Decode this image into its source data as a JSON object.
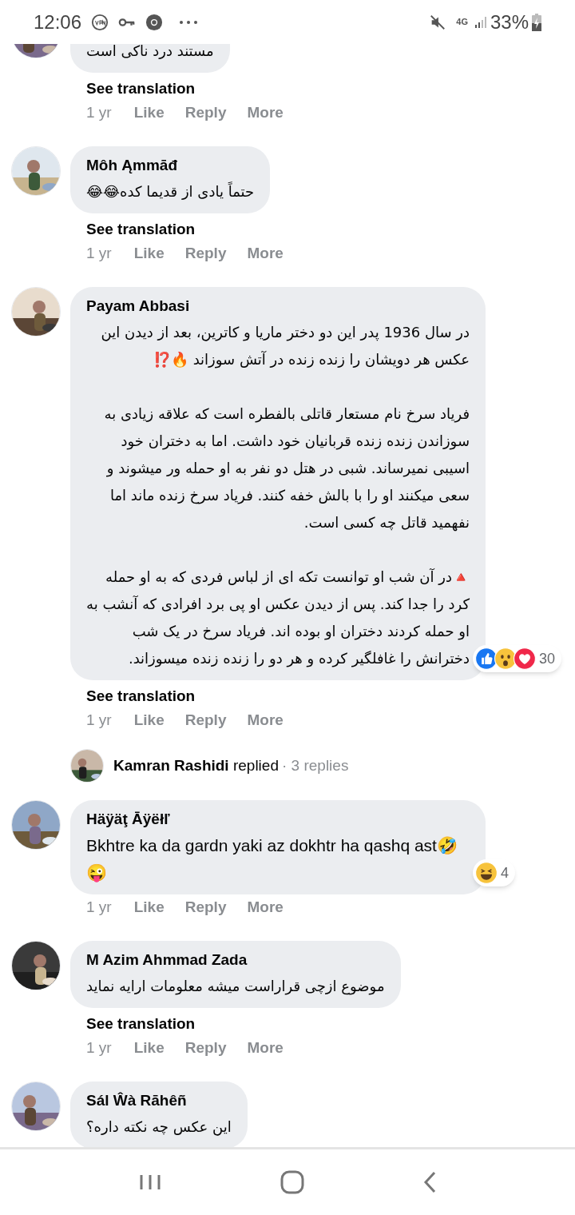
{
  "status_bar": {
    "time": "12:06",
    "network": "4G",
    "battery": "33%"
  },
  "comments": [
    {
      "kind": "comment",
      "clipped": true,
      "paragraphs": [
        "مستند درد ناکی است"
      ],
      "see_translation": "See translation",
      "time": "1 yr",
      "actions": [
        "Like",
        "Reply",
        "More"
      ]
    },
    {
      "kind": "comment",
      "author": "Môh Ąmmāđ",
      "paragraphs": [
        "حتماً یادی از قدیما کده😂😂"
      ],
      "see_translation": "See translation",
      "time": "1 yr",
      "actions": [
        "Like",
        "Reply",
        "More"
      ]
    },
    {
      "kind": "comment",
      "author": "Payam Abbasi",
      "paragraphs": [
        "در سال 1936 پدر این دو دختر ماریا و کاترین، بعد از دیدن این عکس هر دویشان را زنده زنده در آتش سوزاند 🔥⁉️",
        "فریاد سرخ نام مستعار قاتلی بالفطره است که علاقه زیادی به سوزاندن زنده زنده قربانیان خود داشت. اما به دختران خود اسیبی نمیرساند. شبی در هتل دو نفر به او حمله ور میشوند و سعی میکنند او را با بالش خفه کنند. فریاد سرخ زنده ماند اما نفهمید قاتل چه کسی است.",
        "🔺در آن شب او توانست تکه ای از لباس فردی که به او حمله کرد را جدا کند. پس از دیدن عکس او پی برد افرادی که آنشب به او حمله کردند دختران او بوده اند. فریاد سرخ در یک شب دخترانش را غافلگیر کرده و هر دو را زنده زنده میسوزاند."
      ],
      "reactions": {
        "icons": [
          {
            "kind": "like"
          },
          {
            "kind": "wow"
          },
          {
            "kind": "love"
          }
        ],
        "count": "30"
      },
      "see_translation": "See translation",
      "time": "1 yr",
      "actions": [
        "Like",
        "Reply",
        "More"
      ]
    },
    {
      "kind": "reply_summary",
      "text": "**Kamran Rashidi** replied",
      "count": "· 3 replies"
    },
    {
      "kind": "comment",
      "author": "Häÿäţ Āÿëłľ",
      "ltr": true,
      "paragraphs": [
        "Bkhtre ka da gardn yaki az dokhtr ha qashq ast🤣😜"
      ],
      "reactions": {
        "icons": [
          {
            "kind": "haha"
          }
        ],
        "count": "4"
      },
      "time": "1 yr",
      "actions": [
        "Like",
        "Reply",
        "More"
      ]
    },
    {
      "kind": "comment",
      "author": "M Azim Ahmmad Zada",
      "paragraphs": [
        "موضوع ازچی قراراست میشه معلومات ارایه نماید"
      ],
      "see_translation": "See translation",
      "time": "1 yr",
      "actions": [
        "Like",
        "Reply",
        "More"
      ]
    },
    {
      "kind": "comment",
      "author": "Sál Ŵà Rāhêñ",
      "paragraphs": [
        "این عکس چه نکته داره؟"
      ]
    }
  ]
}
